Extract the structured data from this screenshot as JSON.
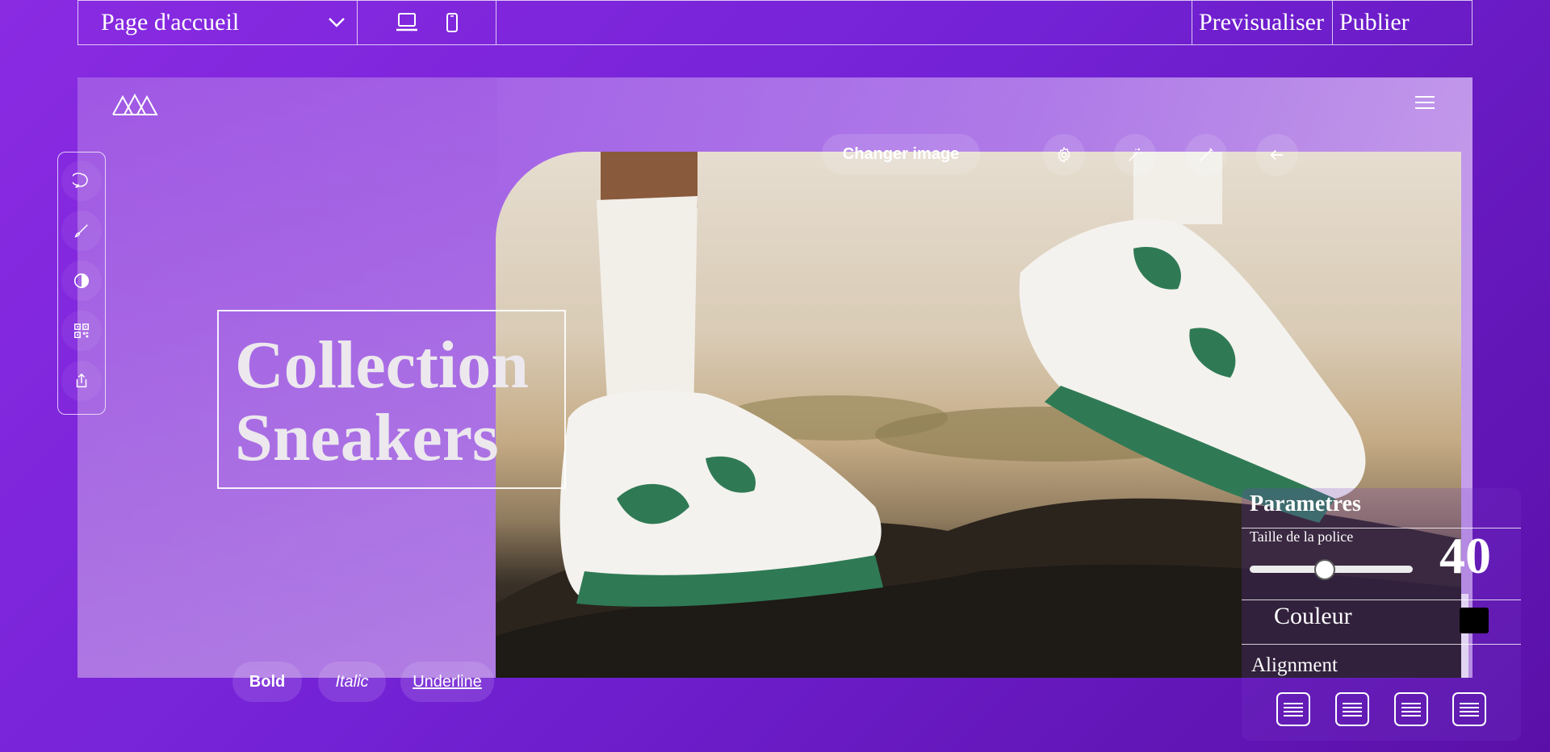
{
  "topbar": {
    "page_select_value": "Page d'accueil",
    "preview_label": "Previsualiser",
    "publish_label": "Publier"
  },
  "hero": {
    "title_line1": "Collection",
    "title_line2": "Sneakers"
  },
  "image_toolbar": {
    "change_image_label": "Changer image",
    "icons": [
      "gear-icon",
      "magic-wand-icon",
      "pen-icon",
      "arrow-left-icon"
    ]
  },
  "side_tools": {
    "icons": [
      "chat-bubble-icon",
      "brush-icon",
      "contrast-icon",
      "qr-code-icon",
      "share-icon"
    ]
  },
  "format": {
    "bold_label": "Bold",
    "italic_label": "Italic",
    "underline_label": "Underline"
  },
  "params": {
    "title": "Parametres",
    "font_size_label": "Taille de la police",
    "font_size_value": "40",
    "font_size_slider_fraction": 0.46,
    "color_label": "Couleur",
    "color_value": "#000000",
    "alignment_label": "Alignment",
    "align_icons": [
      "align-left-icon",
      "align-center-icon",
      "align-right-icon",
      "align-justify-icon"
    ]
  },
  "colors": {
    "background_start": "#8a2be2",
    "background_end": "#5a10a8"
  }
}
